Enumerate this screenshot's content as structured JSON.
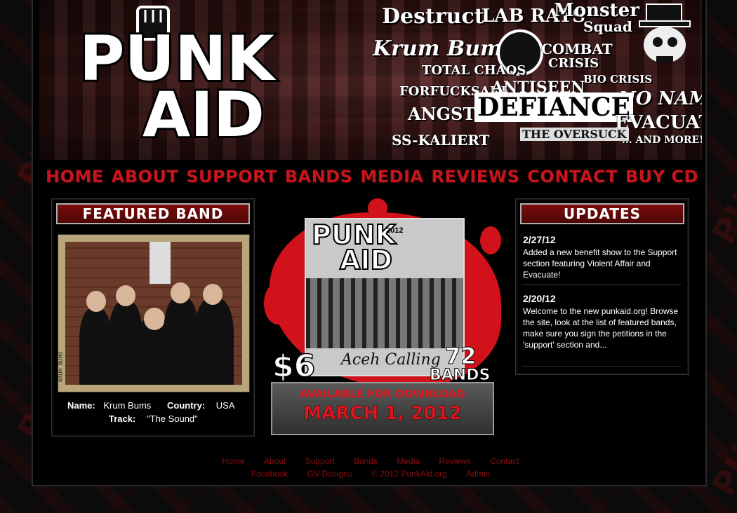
{
  "nav": [
    "HOME",
    "ABOUT",
    "SUPPORT",
    "BANDS",
    "MEDIA",
    "REVIEWS",
    "CONTACT",
    "BUY CD"
  ],
  "logo": {
    "line1": "PUNK",
    "line2": "AID"
  },
  "banner_bands": [
    "Destruct",
    "LAB RATS",
    "Monster",
    "Squad",
    "Krum Bums",
    "COMBAT",
    "CRISIS",
    "TOTAL CHAOS",
    "BIO CRISIS",
    "FORFUCKSAKE",
    "ANTISEEN",
    "NO NAME",
    "ANGST",
    "DEFIANCE",
    "EVACUATE",
    "SS-KALIERT",
    "THE OVERSUCK",
    "... AND MORE!!"
  ],
  "featured": {
    "title": "FEATURED BAND",
    "photo_caption": "KRUM BUMS",
    "name_label": "Name:",
    "name": "Krum Bums",
    "country_label": "Country:",
    "country": "USA",
    "track_label": "Track:",
    "track": "\"The Sound\""
  },
  "promo": {
    "logo1": "PUNK",
    "logo2": "AID",
    "year": "2012",
    "subtitle": "Aceh Calling",
    "price": "$6",
    "bands_count": "72",
    "bands_word": "BANDS",
    "available": "AVAILABLE FOR DOWNLOAD",
    "date": "MARCH 1, 2012"
  },
  "updates": {
    "title": "UPDATES",
    "items": [
      {
        "date": "2/27/12",
        "text": "Added a new benefit show to the Support section featuring Violent Affair and Evacuate!"
      },
      {
        "date": "2/20/12",
        "text": "Welcome to the new punkaid.org! Browse the site, look at the list of featured bands, make sure you sign the petitions in the 'support' section and..."
      }
    ]
  },
  "footer": {
    "row1": [
      "Home",
      "About",
      "Support",
      "Bands",
      "Media",
      "Reviews",
      "Contact"
    ],
    "row2": [
      "Facebook",
      "GV-Designs",
      "© 2012 PunkAid.org",
      "Admin"
    ]
  },
  "colors": {
    "accent": "#c4161c",
    "footer_link": "#8a0d10",
    "panel_title": "#7a0c0c"
  }
}
